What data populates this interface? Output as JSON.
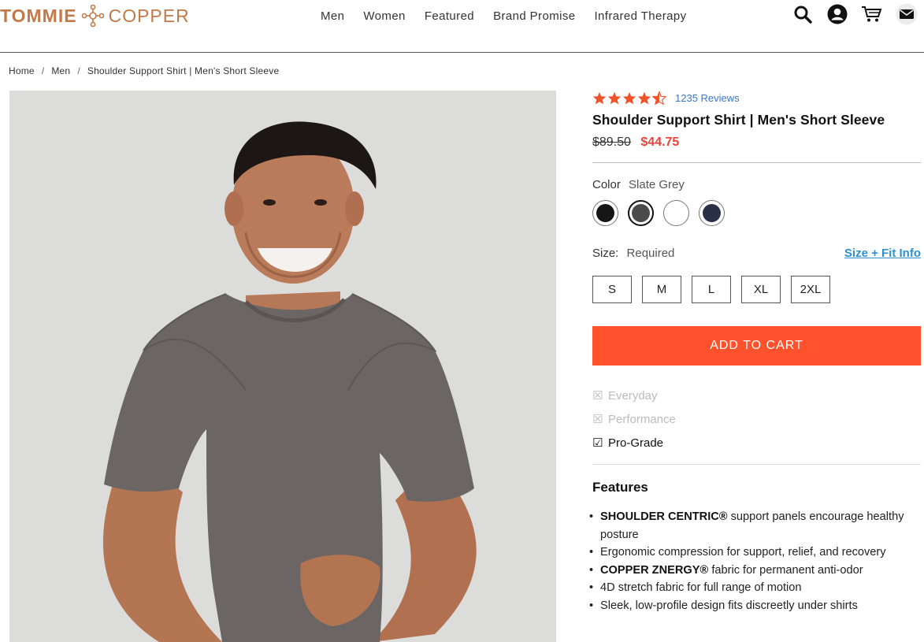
{
  "brand": {
    "name_left": "TOMMIE",
    "name_right": "COPPER",
    "color": "#c37a4a"
  },
  "nav": [
    "Men",
    "Women",
    "Featured",
    "Brand Promise",
    "Infrared Therapy"
  ],
  "header_icons": [
    "search-icon",
    "account-icon",
    "cart-icon",
    "mail-icon"
  ],
  "breadcrumb": [
    "Home",
    "Men",
    "Shoulder Support Shirt | Men's Short Sleeve"
  ],
  "product": {
    "rating": 4.5,
    "reviews": "1235 Reviews",
    "title": "Shoulder Support Shirt | Men's Short Sleeve",
    "old_price": "$89.50",
    "new_price": "$44.75",
    "color_label": "Color",
    "color_value": "Slate Grey",
    "colors": [
      {
        "name": "Black",
        "hex": "#161616"
      },
      {
        "name": "Slate Grey",
        "hex": "#4b4b4b",
        "selected": true
      },
      {
        "name": "White",
        "hex": "#ffffff"
      },
      {
        "name": "Navy",
        "hex": "#2a3147"
      }
    ],
    "size_label": "Size:",
    "size_required": "Required",
    "size_fit_link": "Size + Fit Info",
    "sizes": [
      "S",
      "M",
      "L",
      "XL",
      "2XL"
    ],
    "add_to_cart": "ADD TO CART",
    "grades": [
      {
        "label": "Everyday",
        "state": "disabled"
      },
      {
        "label": "Performance",
        "state": "disabled"
      },
      {
        "label": "Pro-Grade",
        "state": "checked"
      }
    ],
    "features_title": "Features",
    "features": [
      {
        "bold": "SHOULDER CENTRIC®",
        "text": " support panels encourage healthy posture"
      },
      {
        "bold": "",
        "text": "Ergonomic compression for support, relief, and recovery"
      },
      {
        "bold": "COPPER ZNERGY®",
        "text": " fabric for permanent anti-odor"
      },
      {
        "bold": "",
        "text": "4D stretch fabric for full range of motion"
      },
      {
        "bold": "",
        "text": "Sleek, low-profile design fits discreetly under shirts"
      }
    ]
  },
  "colors": {
    "accent": "#fe512c",
    "sale": "#e8433a",
    "link": "#3a76c4",
    "star": "#f0522c"
  }
}
